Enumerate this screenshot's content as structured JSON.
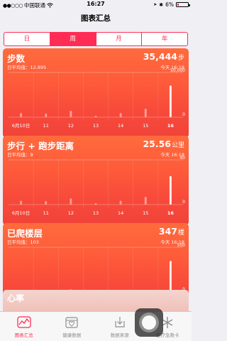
{
  "status_bar": {
    "carrier": "中国联通",
    "time": "16:27",
    "battery": "6%"
  },
  "header": {
    "title": "图表汇总"
  },
  "segments": [
    {
      "label": "日",
      "selected": false
    },
    {
      "label": "周",
      "selected": true
    },
    {
      "label": "月",
      "selected": false
    },
    {
      "label": "年",
      "selected": false
    }
  ],
  "cards": [
    {
      "title": "步数",
      "avg_label": "日平均值：12,895",
      "value": "35,444",
      "unit": "步",
      "time": "今天 16:18",
      "chart_data": {
        "type": "bar",
        "categories": [
          "6月10日",
          "11",
          "12",
          "13",
          "14",
          "15",
          "16"
        ],
        "values": [
          4700,
          4200,
          7200,
          1600,
          4700,
          9500,
          35444
        ],
        "ylim": [
          0,
          50000
        ],
        "y_tick_labels": [
          "50,000",
          "0"
        ],
        "highlight": "16"
      }
    },
    {
      "title": "步行 + 跑步距离",
      "avg_label": "日平均值：9",
      "value": "25.56",
      "unit": "公里",
      "time": "今天 16:18",
      "chart_data": {
        "type": "bar",
        "categories": [
          "6月10日",
          "11",
          "12",
          "13",
          "14",
          "15",
          "16"
        ],
        "values": [
          3.5,
          3.2,
          5.5,
          1.2,
          3.5,
          7,
          25.56
        ],
        "ylim": [
          0,
          40
        ],
        "y_tick_labels": [
          "40",
          "0"
        ],
        "highlight": "16"
      }
    },
    {
      "title": "已爬楼层",
      "avg_label": "日平均值：103",
      "value": "347",
      "unit": "楼",
      "time": "今天 16:18",
      "chart_data": {
        "type": "bar",
        "categories": [
          "6月10日",
          "11",
          "12",
          "13",
          "14",
          "15",
          "16"
        ],
        "values": [
          7,
          4,
          30,
          7,
          5,
          25,
          347
        ],
        "ylim": [
          0,
          500
        ],
        "y_tick_labels": [
          "500",
          "0"
        ],
        "highlight": "16"
      }
    }
  ],
  "partial_card": {
    "title": "心率"
  },
  "tabs": [
    {
      "label": "图表汇总",
      "icon": "chart-icon",
      "active": true
    },
    {
      "label": "健康数据",
      "icon": "health-data-icon",
      "active": false
    },
    {
      "label": "数据来源",
      "icon": "sources-icon",
      "active": false
    },
    {
      "label": "医疗急救卡",
      "icon": "medical-id-icon",
      "active": false
    }
  ],
  "colors": {
    "accent": "#ff2d55",
    "card_top": "#ff6b3d",
    "card_bottom": "#f04238"
  }
}
